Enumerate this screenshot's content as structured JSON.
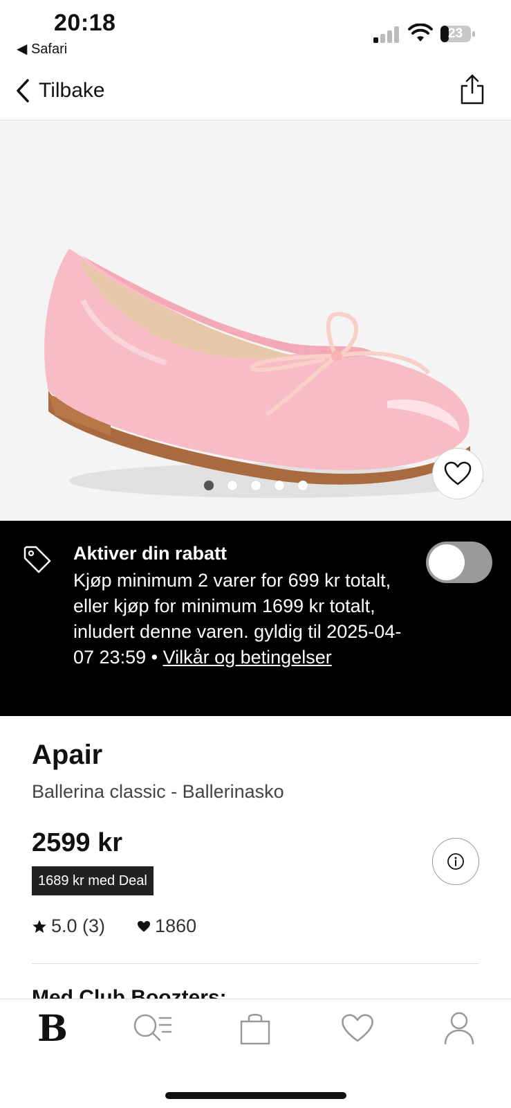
{
  "status_bar": {
    "time": "20:18",
    "back_app": "◀ Safari",
    "battery": "23"
  },
  "nav": {
    "back_label": "Tilbake"
  },
  "gallery": {
    "image_count": 5,
    "active_index": 0,
    "favorite_icon": "heart-outline-icon"
  },
  "promo": {
    "title": "Aktiver din rabatt",
    "body": "Kjøp minimum 2 varer for 699 kr totalt, eller kjøp for minimum 1699 kr totalt, inludert denne varen. gyldig til 2025-04-07 23:59 • ",
    "link": "Vilkår og betingelser",
    "toggle_on": false
  },
  "product": {
    "brand": "Apair",
    "name": "Ballerina classic - Ballerinasko",
    "price": "2599 kr",
    "deal_price": "1689 kr med Deal",
    "rating": "5.0 (3)",
    "likes": "1860",
    "club_heading": "Med Club Boozters:"
  },
  "tab_bar": {
    "logo": "B",
    "items": [
      "home",
      "search",
      "bag",
      "favorites",
      "profile"
    ]
  },
  "colors": {
    "shoe": "#f5b9c3",
    "promo_bg": "#000000",
    "deal_bg": "#222222"
  }
}
